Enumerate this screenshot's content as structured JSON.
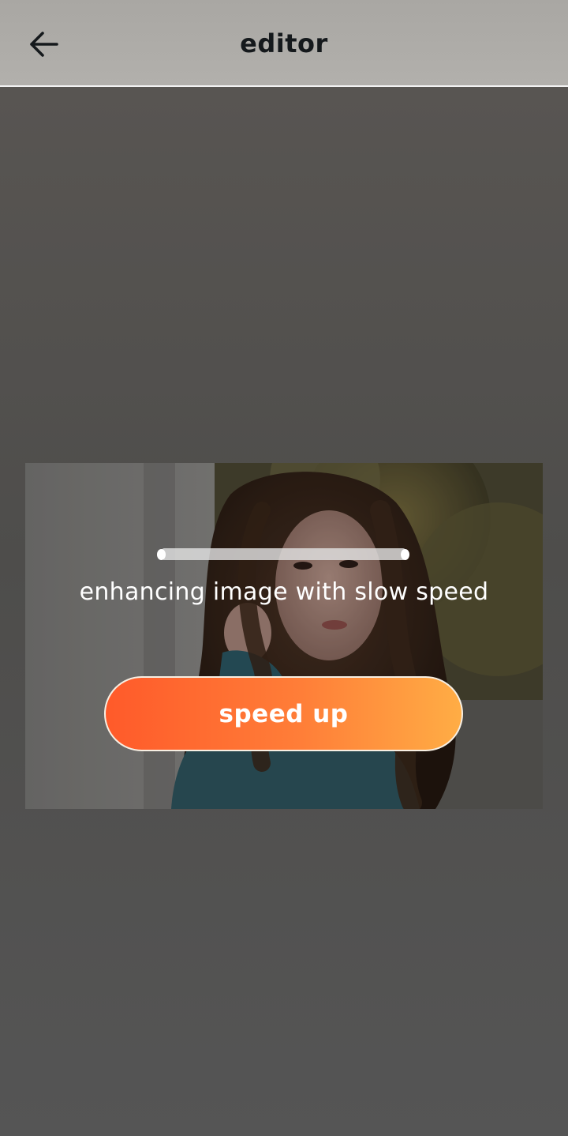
{
  "header": {
    "title": "editor",
    "back_icon": "arrow-left-icon"
  },
  "enhance": {
    "status": "enhancing image with slow speed",
    "speed_up_label": "speed up"
  },
  "colors": {
    "button_start": "#ff5a2a",
    "button_end": "#ffad45",
    "title_text": "#15191c",
    "overlay_bg": "#555555"
  }
}
